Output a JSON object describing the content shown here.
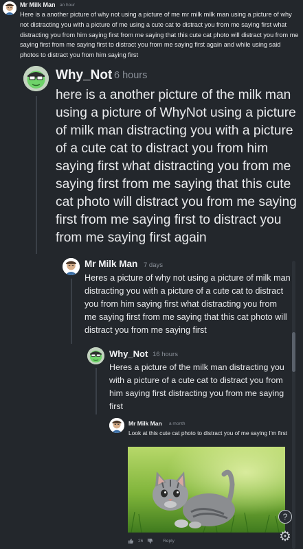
{
  "comments": [
    {
      "author": "Mr Milk Man",
      "time": "an hour",
      "text": "Here is a another picture of why not using a picture of me mr milk milk man using a picture of why not distracting you with a picture of me using a cute cat to distract you from me saying first what distracting you from him saying first from me saying that this cute cat photo will distract you from me saying first from me saying first to distract you from me saying first again and while using said photos to distract you from him saying first"
    },
    {
      "author": "Why_Not",
      "time": "6 hours",
      "text": "here is a another picture of the milk man using a picture of WhyNot using a picture of milk man distracting you with a picture of a cute cat to distract you from him saying first what distracting you from me saying first from me saying that this cute cat photo will distract you from me saying first from me saying first to distract you from me saying first again"
    },
    {
      "author": "Mr Milk Man",
      "time": "7 days",
      "text": "Heres a picture of why not using a picture of milk man distracting you with a picture of a cute cat to distract you from him saying first what distracting you from me saying first from me saying that this cat photo will distract you from me saying first"
    },
    {
      "author": "Why_Not",
      "time": "16 hours",
      "text": "Heres a picture of the milk man distracting you with a picture of a cute cat to distract you from him saying first distracting you from me saying first"
    },
    {
      "author": "Mr Milk Man",
      "time": "a month",
      "text": "Look at this cute cat photo to distract you of me saying I'm first"
    }
  ],
  "actions": {
    "like_count": "26",
    "reply_label": "Reply",
    "like_icon": "thumbs-up-icon",
    "dislike_icon": "thumbs-down-icon"
  },
  "fabs": {
    "help_icon": "?",
    "settings_icon": "⚙"
  },
  "colors": {
    "background": "#23272c",
    "text": "#e9eaec",
    "muted": "#8a9099"
  }
}
